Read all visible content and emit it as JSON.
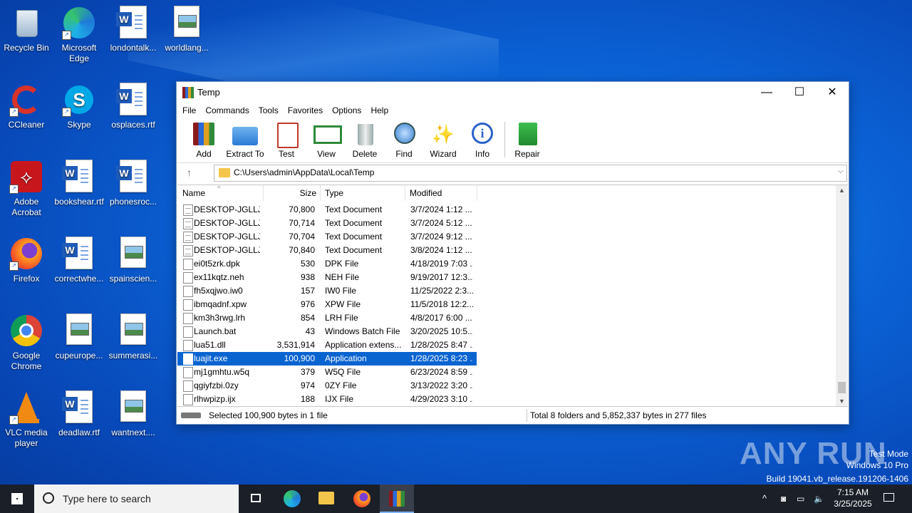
{
  "desktop": {
    "icons": [
      {
        "label": "Recycle Bin"
      },
      {
        "label": "Microsoft Edge"
      },
      {
        "label": "londontalk..."
      },
      {
        "label": "worldlang..."
      },
      {
        "label": "CCleaner"
      },
      {
        "label": "Skype"
      },
      {
        "label": "osplaces.rtf"
      },
      {
        "label": "Adobe Acrobat"
      },
      {
        "label": "bookshear.rtf"
      },
      {
        "label": "phonesroc..."
      },
      {
        "label": "Firefox"
      },
      {
        "label": "correctwhe..."
      },
      {
        "label": "spainscien..."
      },
      {
        "label": "Google Chrome"
      },
      {
        "label": "cupeurope..."
      },
      {
        "label": "summerasi..."
      },
      {
        "label": "VLC media player"
      },
      {
        "label": "deadlaw.rtf"
      },
      {
        "label": "wantnext...."
      }
    ]
  },
  "window": {
    "title": "Temp",
    "controls": {
      "minimize": "—",
      "maximize": "☐",
      "close": "✕"
    },
    "menu": [
      "File",
      "Commands",
      "Tools",
      "Favorites",
      "Options",
      "Help"
    ],
    "toolbar": [
      "Add",
      "Extract To",
      "Test",
      "View",
      "Delete",
      "Find",
      "Wizard",
      "Info",
      "Repair"
    ],
    "address": "C:\\Users\\admin\\AppData\\Local\\Temp",
    "columns": {
      "name": "Name",
      "size": "Size",
      "type": "Type",
      "modified": "Modified"
    },
    "files": [
      {
        "name": "DESKTOP-JGLLJ...",
        "size": "70,800",
        "type": "Text Document",
        "modified": "3/7/2024 1:12 ..."
      },
      {
        "name": "DESKTOP-JGLLJ...",
        "size": "70,714",
        "type": "Text Document",
        "modified": "3/7/2024 5:12 ..."
      },
      {
        "name": "DESKTOP-JGLLJ...",
        "size": "70,704",
        "type": "Text Document",
        "modified": "3/7/2024 9:12 ..."
      },
      {
        "name": "DESKTOP-JGLLJ...",
        "size": "70,840",
        "type": "Text Document",
        "modified": "3/8/2024 1:12 ..."
      },
      {
        "name": "ei0t5zrk.dpk",
        "size": "530",
        "type": "DPK File",
        "modified": "4/18/2019 7:03 ..."
      },
      {
        "name": "ex11kqtz.neh",
        "size": "938",
        "type": "NEH File",
        "modified": "9/19/2017 12:3..."
      },
      {
        "name": "fh5xqjwo.iw0",
        "size": "157",
        "type": "IW0 File",
        "modified": "11/25/2022 2:3..."
      },
      {
        "name": "ibmqadnf.xpw",
        "size": "976",
        "type": "XPW File",
        "modified": "11/5/2018 12:2..."
      },
      {
        "name": "km3h3rwg.lrh",
        "size": "854",
        "type": "LRH File",
        "modified": "4/8/2017 6:00 ..."
      },
      {
        "name": "Launch.bat",
        "size": "43",
        "type": "Windows Batch File",
        "modified": "3/20/2025 10:5..."
      },
      {
        "name": "lua51.dll",
        "size": "3,531,914",
        "type": "Application extens...",
        "modified": "1/28/2025 8:47 ..."
      },
      {
        "name": "luajit.exe",
        "size": "100,900",
        "type": "Application",
        "modified": "1/28/2025 8:23 ..."
      },
      {
        "name": "mj1gmhtu.w5q",
        "size": "379",
        "type": "W5Q File",
        "modified": "6/23/2024 8:59 ..."
      },
      {
        "name": "qgiyfzbi.0zy",
        "size": "974",
        "type": "0ZY File",
        "modified": "3/13/2022 3:20 ..."
      },
      {
        "name": "rlhwpizp.ijx",
        "size": "188",
        "type": "IJX File",
        "modified": "4/29/2023 3:10 ..."
      }
    ],
    "status_left": "Selected 100,900 bytes in 1 file",
    "status_right": "Total 8 folders and 5,852,337 bytes in 277 files"
  },
  "taskbar": {
    "search_placeholder": "Type here to search",
    "time": "7:15 AM",
    "date": "3/25/2025"
  },
  "watermark": {
    "line1": "Test Mode",
    "line2": "Windows 10 Pro",
    "line3": "Build 19041.vb_release.191206-1406",
    "brand": "ANY RUN"
  }
}
